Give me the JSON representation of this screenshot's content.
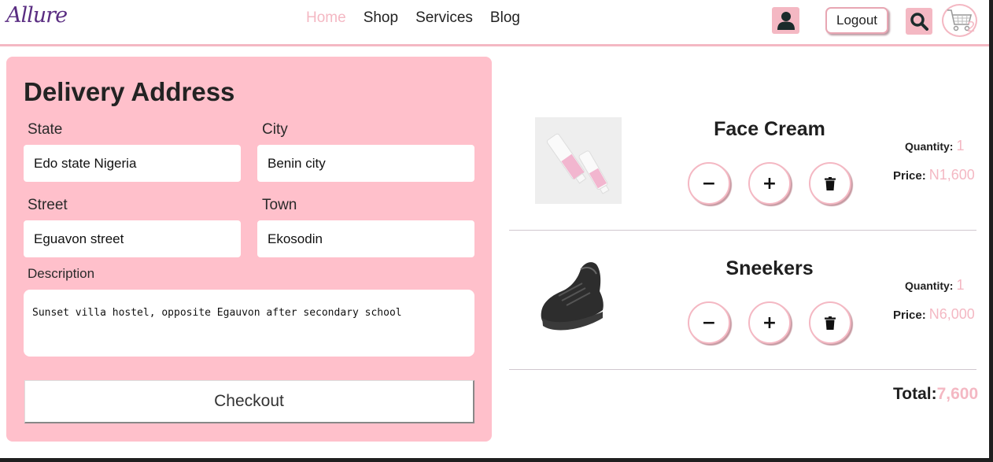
{
  "header": {
    "logo": "Allure",
    "nav": [
      "Home",
      "Shop",
      "Services",
      "Blog"
    ],
    "logout_label": "Logout",
    "cart_count": "2"
  },
  "delivery": {
    "title": "Delivery Address",
    "state": {
      "label": "State",
      "value": "Edo state Nigeria"
    },
    "city": {
      "label": "City",
      "value": "Benin city"
    },
    "street": {
      "label": "Street",
      "value": "Eguavon street"
    },
    "town": {
      "label": "Town",
      "value": "Ekosodin"
    },
    "description": {
      "label": "Description",
      "value": "Sunset villa hostel, opposite Egauvon after secondary school"
    },
    "checkout_label": "Checkout"
  },
  "cart": {
    "items": [
      {
        "name": "Face Cream",
        "quantity_label": "Quantity:",
        "quantity": "1",
        "price_label": "Price:",
        "price": "N1,600",
        "image_icon": "face-cream-image"
      },
      {
        "name": "Sneekers",
        "quantity_label": "Quantity:",
        "quantity": "1",
        "price_label": "Price:",
        "price": "N6,000",
        "image_icon": "sneaker-image"
      }
    ],
    "controls": {
      "minus": "−",
      "plus": "+"
    },
    "total_label": "Total:",
    "total_value": "7,600"
  },
  "colors": {
    "accent_pink": "#f4b8c3",
    "panel_pink": "#ffc0cb",
    "logo_purple": "#5a2d82"
  }
}
